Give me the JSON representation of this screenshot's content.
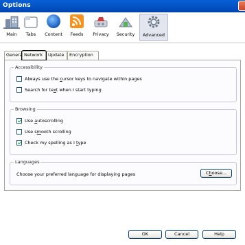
{
  "window": {
    "title": "Options"
  },
  "panes": [
    {
      "label": "Main",
      "icon": "main-icon"
    },
    {
      "label": "Tabs",
      "icon": "tabs-icon"
    },
    {
      "label": "Content",
      "icon": "content-icon"
    },
    {
      "label": "Feeds",
      "icon": "feeds-icon"
    },
    {
      "label": "Privacy",
      "icon": "privacy-icon"
    },
    {
      "label": "Security",
      "icon": "security-icon"
    },
    {
      "label": "Advanced",
      "icon": "advanced-icon",
      "selected": true
    }
  ],
  "tabs": [
    {
      "label": "General"
    },
    {
      "label": "Network",
      "focused": true
    },
    {
      "label": "Update"
    },
    {
      "label": "Encryption"
    }
  ],
  "accessibility": {
    "title": "Accessibility",
    "caret": {
      "pre": "Always use the ",
      "u": "c",
      "post": "ursor keys to navigate within pages",
      "checked": false
    },
    "typeahead": {
      "pre": "Search for te",
      "u": "x",
      "post": "t when I start typing",
      "checked": false
    }
  },
  "browsing": {
    "title": "Browsing",
    "autoscroll": {
      "pre": "Use ",
      "u": "a",
      "post": "utoscrolling",
      "checked": true
    },
    "smooth": {
      "pre": "Use s",
      "u": "m",
      "post": "ooth scrolling",
      "checked": false
    },
    "spell": {
      "pre": "Check my spelling as I ",
      "u": "t",
      "post": "ype",
      "checked": true
    }
  },
  "languages": {
    "title": "Languages",
    "text": "Choose your preferred language for displaying pages",
    "choose": {
      "pre": "C",
      "u": "h",
      "post": "oose..."
    }
  },
  "buttons": {
    "ok": "OK",
    "cancel": "Cancel",
    "help": "Help"
  },
  "colors": {
    "titlebar": "#0352c4",
    "accent": "#21a121"
  }
}
